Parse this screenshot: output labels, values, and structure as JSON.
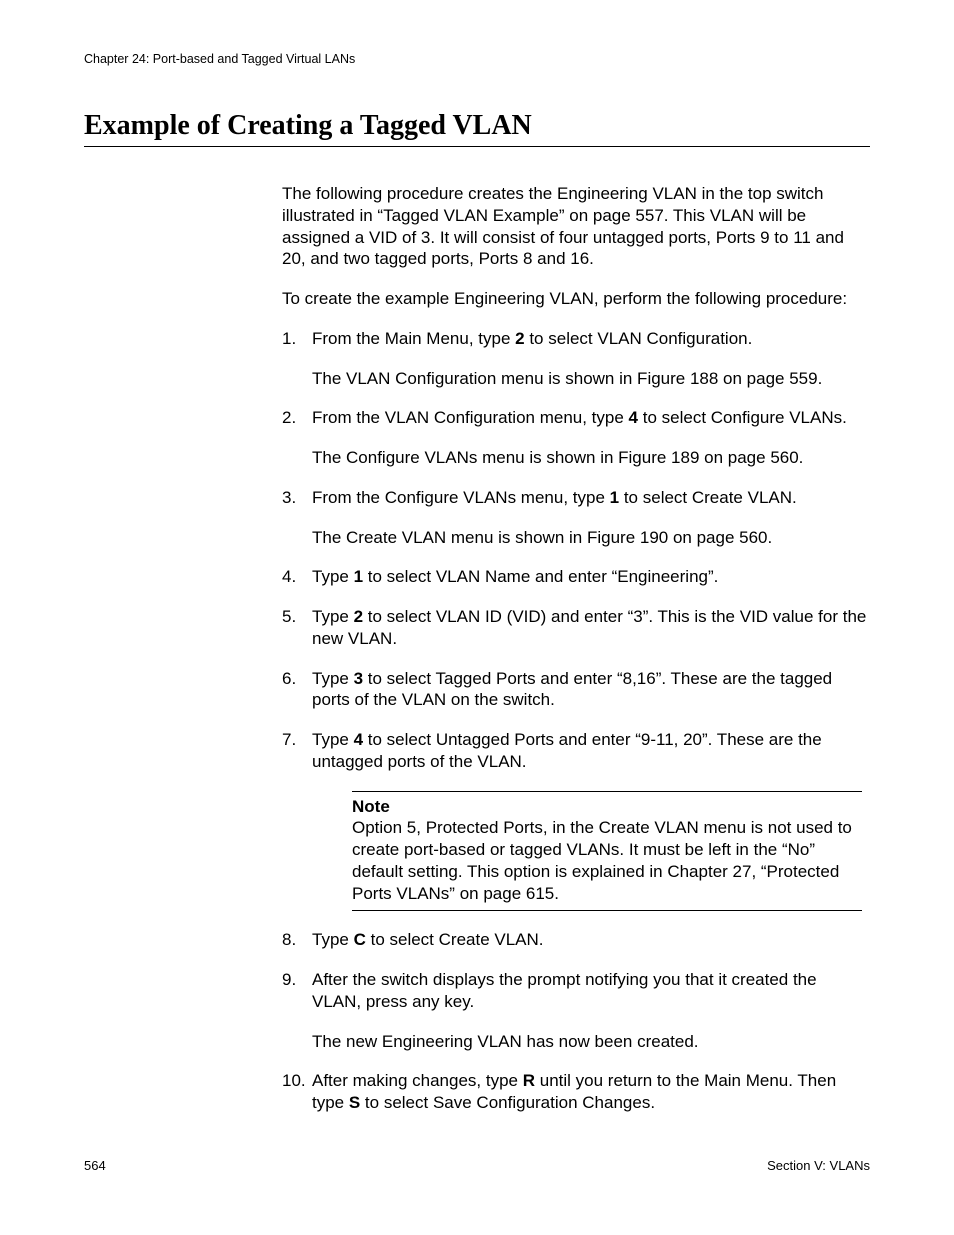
{
  "header": {
    "chapter": "Chapter 24: Port-based and Tagged Virtual LANs"
  },
  "title": "Example of Creating a Tagged VLAN",
  "intro": {
    "p1": "The following procedure creates the Engineering VLAN in the top switch illustrated in “Tagged VLAN Example” on page 557. This VLAN will be assigned a VID of 3. It will consist of four untagged ports, Ports 9 to 11 and 20, and two tagged ports, Ports 8 and 16.",
    "p2": "To create the example Engineering VLAN, perform the following procedure:"
  },
  "steps": {
    "s1a": "From the Main Menu, type ",
    "s1b": "2",
    "s1c": " to select VLAN Configuration.",
    "s1sub": "The VLAN Configuration menu is shown in Figure 188 on page 559.",
    "s2a": "From the VLAN Configuration menu, type ",
    "s2b": "4",
    "s2c": " to select Configure VLANs.",
    "s2sub": "The Configure VLANs menu is shown in Figure 189 on page 560.",
    "s3a": "From the Configure VLANs menu, type ",
    "s3b": "1",
    "s3c": " to select Create VLAN.",
    "s3sub": "The Create VLAN menu is shown in Figure 190 on page 560.",
    "s4a": "Type ",
    "s4b": "1",
    "s4c": " to select VLAN Name and enter “Engineering”.",
    "s5a": "Type ",
    "s5b": "2",
    "s5c": " to select VLAN ID (VID) and enter “3”. This is the VID value for the new VLAN.",
    "s6a": "Type ",
    "s6b": "3",
    "s6c": " to select Tagged Ports and enter “8,16”. These are the tagged ports of the VLAN on the switch.",
    "s7a": "Type ",
    "s7b": "4",
    "s7c": " to select Untagged Ports and enter “9-11, 20”. These are the untagged ports of the VLAN.",
    "s8a": "Type ",
    "s8b": "C",
    "s8c": " to select Create VLAN.",
    "s9": "After the switch displays the prompt notifying you that it created the VLAN, press any key.",
    "s9sub": "The new Engineering VLAN has now been created.",
    "s10a": "After making changes, type ",
    "s10b": "R",
    "s10c": " until you return to the Main Menu. Then type ",
    "s10d": "S",
    "s10e": " to select Save Configuration Changes."
  },
  "note": {
    "label": "Note",
    "body": "Option 5, Protected Ports, in the Create VLAN menu is not used to create port-based or tagged VLANs. It must be left in the “No” default setting. This option is explained in Chapter 27, “Protected Ports VLANs” on page 615."
  },
  "footer": {
    "page": "564",
    "section": "Section V: VLANs"
  }
}
